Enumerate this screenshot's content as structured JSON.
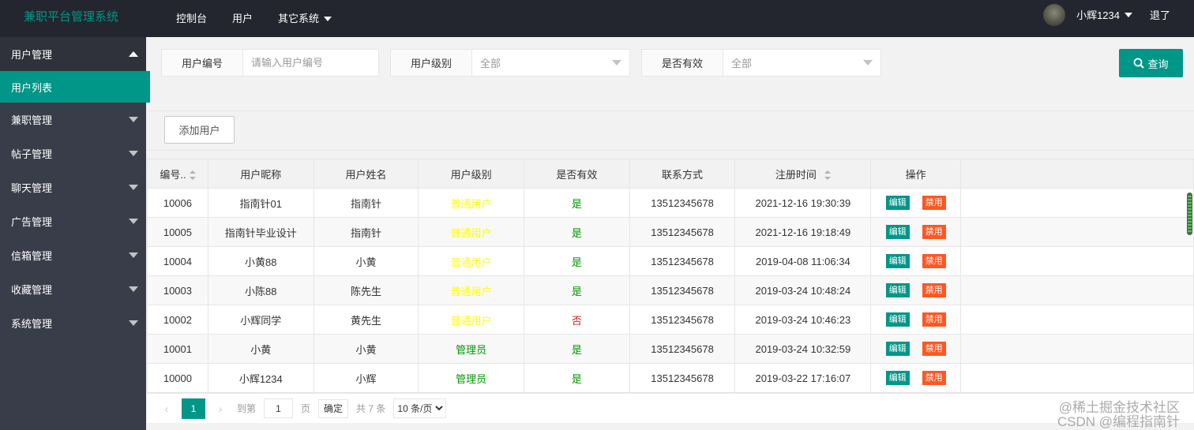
{
  "header": {
    "logo": "兼职平台管理系统",
    "nav": [
      {
        "label": "控制台"
      },
      {
        "label": "用户"
      },
      {
        "label": "其它系统"
      }
    ],
    "username": "小辉1234",
    "logout": "退了"
  },
  "sidebar": {
    "groups": [
      {
        "label": "用户管理",
        "open": true,
        "sub": "用户列表"
      },
      {
        "label": "兼职管理"
      },
      {
        "label": "帖子管理"
      },
      {
        "label": "聊天管理"
      },
      {
        "label": "广告管理"
      },
      {
        "label": "信箱管理"
      },
      {
        "label": "收藏管理"
      },
      {
        "label": "系统管理"
      }
    ]
  },
  "filters": {
    "user_id_label": "用户编号",
    "user_id_placeholder": "请输入用户编号",
    "level_label": "用户级别",
    "level_value": "全部",
    "valid_label": "是否有效",
    "valid_value": "全部",
    "search_label": "查询"
  },
  "toolbar": {
    "add_user": "添加用户"
  },
  "table": {
    "columns": [
      "编号..",
      "用户昵称",
      "用户姓名",
      "用户级别",
      "是否有效",
      "联系方式",
      "注册时间",
      "操作"
    ],
    "edit_label": "编辑",
    "ban_label": "禁用",
    "rows": [
      {
        "id": "10006",
        "nickname": "指南针01",
        "name": "指南针",
        "level": "普通用户",
        "valid": "是",
        "phone": "13512345678",
        "time": "2021-12-16 19:30:39"
      },
      {
        "id": "10005",
        "nickname": "指南针毕业设计",
        "name": "指南针",
        "level": "普通用户",
        "valid": "是",
        "phone": "13512345678",
        "time": "2021-12-16 19:18:49"
      },
      {
        "id": "10004",
        "nickname": "小黄88",
        "name": "小黄",
        "level": "普通用户",
        "valid": "是",
        "phone": "13512345678",
        "time": "2019-04-08 11:06:34"
      },
      {
        "id": "10003",
        "nickname": "小陈88",
        "name": "陈先生",
        "level": "普通用户",
        "valid": "是",
        "phone": "13512345678",
        "time": "2019-03-24 10:48:24"
      },
      {
        "id": "10002",
        "nickname": "小辉同学",
        "name": "黄先生",
        "level": "普通用户",
        "valid": "否",
        "phone": "13512345678",
        "time": "2019-03-24 10:46:23"
      },
      {
        "id": "10001",
        "nickname": "小黄",
        "name": "小黄",
        "level": "管理员",
        "valid": "是",
        "phone": "13512345678",
        "time": "2019-03-24 10:32:59"
      },
      {
        "id": "10000",
        "nickname": "小辉1234",
        "name": "小辉",
        "level": "管理员",
        "valid": "是",
        "phone": "13512345678",
        "time": "2019-03-22 17:16:07"
      }
    ]
  },
  "pager": {
    "current": "1",
    "goto_label": "到第",
    "goto_value": "1",
    "page_unit": "页",
    "confirm": "确定",
    "total": "共 7 条",
    "per_page": "10 条/页"
  },
  "watermark": {
    "line1": "@稀土掘金技术社区",
    "line2": "CSDN @编程指南针"
  }
}
